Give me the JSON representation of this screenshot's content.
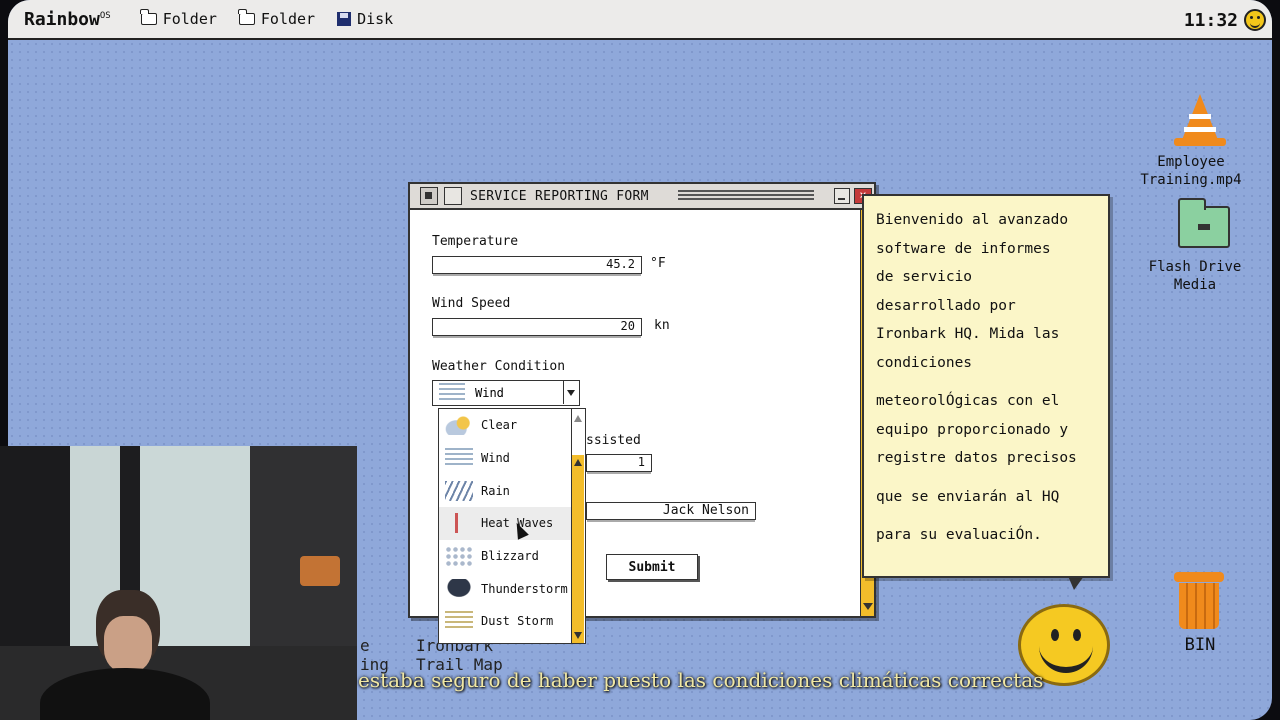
{
  "menubar": {
    "logo": "Rainbow",
    "logo_sup": "OS",
    "items": [
      {
        "label": "Folder",
        "icon": "folder-icon"
      },
      {
        "label": "Folder",
        "icon": "folder-icon"
      },
      {
        "label": "Disk",
        "icon": "disk-icon"
      }
    ],
    "clock": "11:32"
  },
  "window": {
    "title": "SERVICE REPORTING FORM",
    "close_glyph": "×",
    "temperature": {
      "label": "Temperature",
      "value": "45.2",
      "unit": "°F"
    },
    "wind_speed": {
      "label": "Wind Speed",
      "value": "20",
      "unit": "kn"
    },
    "weather": {
      "label": "Weather Condition",
      "selected": "Wind"
    },
    "assisted": {
      "label_partial": "ssisted",
      "value": "1"
    },
    "name": {
      "value": "Jack Nelson"
    },
    "submit_label": "Submit"
  },
  "dropdown": {
    "options": [
      {
        "label": "Clear",
        "icon": "clear-weather-icon"
      },
      {
        "label": "Wind",
        "icon": "wind-icon"
      },
      {
        "label": "Rain",
        "icon": "rain-icon"
      },
      {
        "label": "Heat Waves",
        "icon": "heat-waves-icon"
      },
      {
        "label": "Blizzard",
        "icon": "blizzard-icon"
      },
      {
        "label": "Thunderstorm",
        "icon": "thunderstorm-icon"
      },
      {
        "label": "Dust Storm",
        "icon": "dust-storm-icon"
      }
    ],
    "hovered": "Heat Waves"
  },
  "bubble": {
    "lines": [
      "Bienvenido al avanzado",
      "software de informes",
      "de servicio",
      "desarrollado por",
      "Ironbark HQ. Mida las",
      "condiciones",
      "meteorolÓgicas con el",
      "equipo proporcionado y",
      "registre datos precisos",
      "que se enviarán al HQ",
      "para su evaluaciÓn."
    ]
  },
  "desktop": {
    "employee_training": {
      "line1": "Employee",
      "line2": "Training.mp4"
    },
    "flash_drive": {
      "line1": "Flash Drive",
      "line2": "Media"
    },
    "bin": "BIN",
    "partial_1": "Ironbark",
    "partial_2": "Trail Map",
    "partial_3": "e",
    "partial_4": "ing"
  },
  "subtitle": "estaba seguro de haber puesto las condiciones climáticas correctas",
  "colors": {
    "desktop_bg": "#8fa8da",
    "accent_scroll": "#f3bd2b",
    "bubble_bg": "#fbf6c8",
    "close_red": "#c43a3a"
  }
}
